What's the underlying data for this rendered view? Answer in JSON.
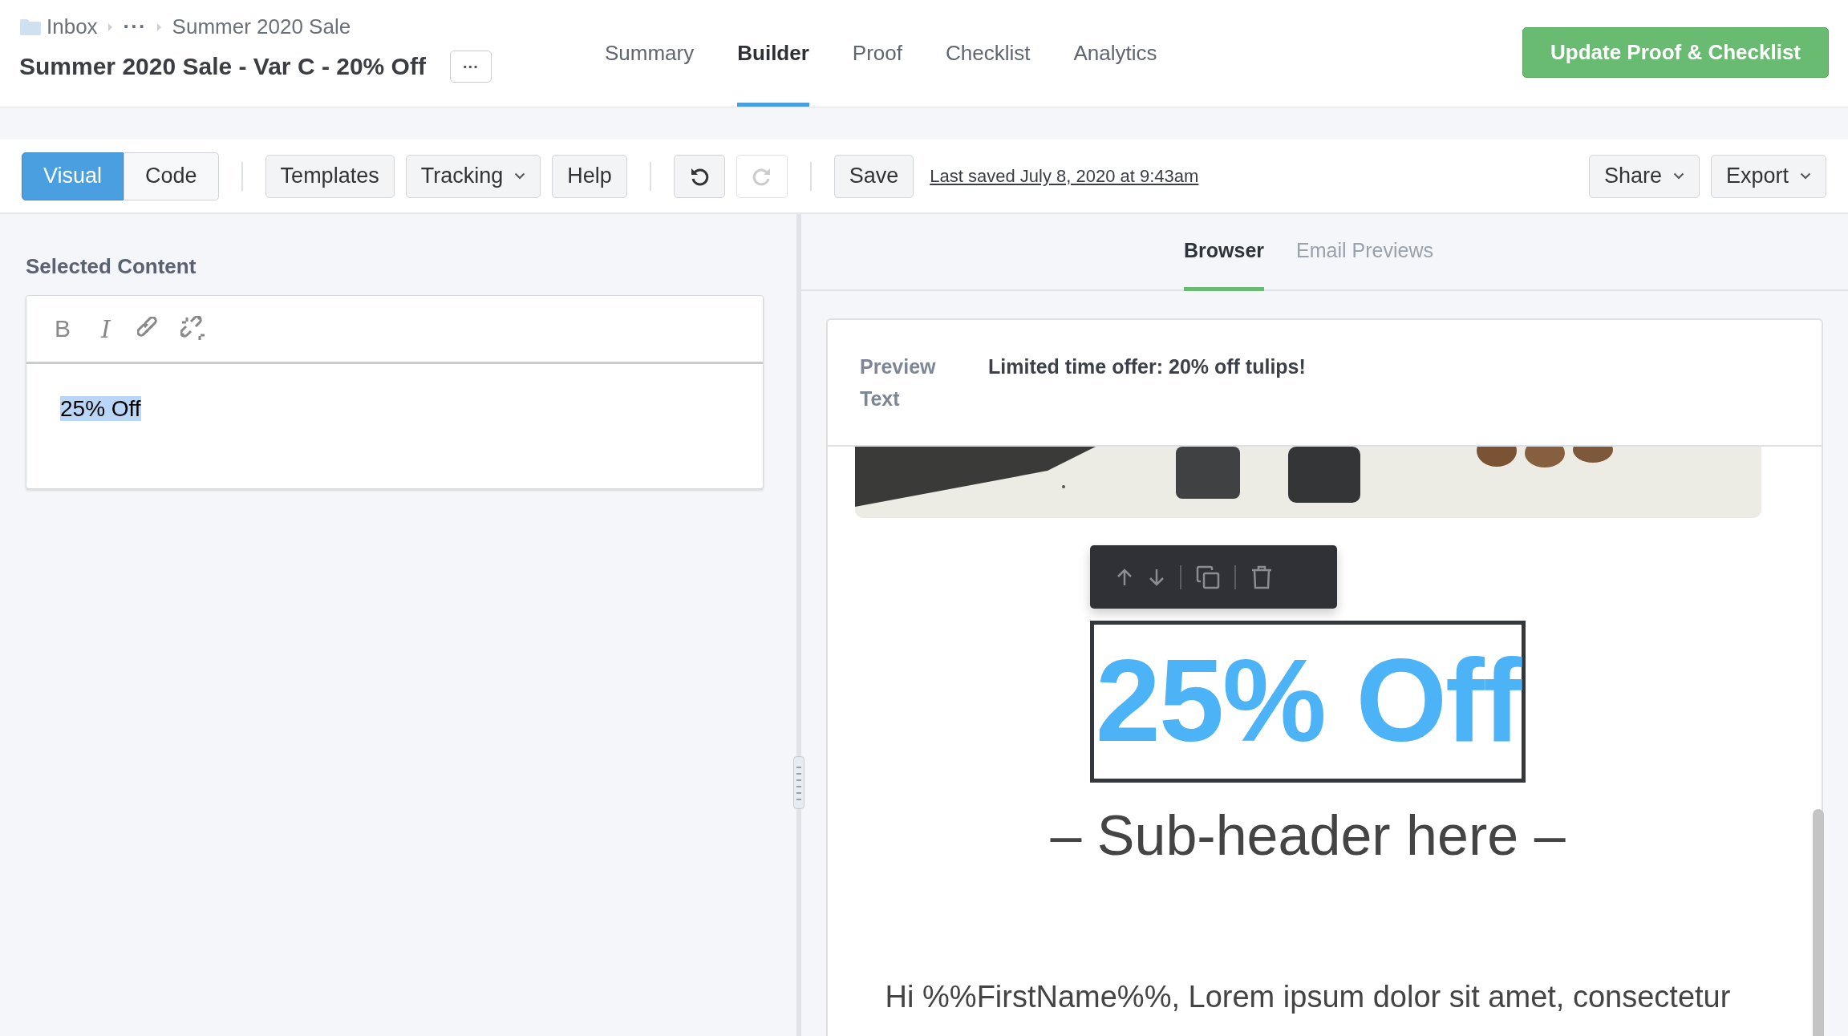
{
  "breadcrumb": [
    {
      "label": "Inbox",
      "kind": "folder"
    },
    {
      "label": "···",
      "kind": "more"
    },
    {
      "label": "Summer 2020 Sale",
      "kind": "text"
    }
  ],
  "title": "Summer 2020 Sale - Var C - 20% Off",
  "title_menu": "···",
  "nav_tabs": [
    {
      "label": "Summary",
      "selected": false
    },
    {
      "label": "Builder",
      "selected": true
    },
    {
      "label": "Proof",
      "selected": false
    },
    {
      "label": "Checklist",
      "selected": false
    },
    {
      "label": "Analytics",
      "selected": false
    }
  ],
  "primary_action": "Update Proof & Checklist",
  "toolbar": {
    "modes": [
      {
        "label": "Visual",
        "selected": true
      },
      {
        "label": "Code",
        "selected": false
      }
    ],
    "buttons": [
      {
        "label": "Templates",
        "kind": "plain"
      },
      {
        "label": "Tracking",
        "kind": "dropdown"
      },
      {
        "label": "Help",
        "kind": "plain"
      }
    ],
    "undo": {
      "disabled": false
    },
    "redo": {
      "disabled": true
    },
    "save": "Save",
    "last_saved": "Last saved July 8, 2020 at 9:43am",
    "right_buttons": [
      {
        "label": "Share",
        "kind": "dropdown"
      },
      {
        "label": "Export",
        "kind": "dropdown"
      }
    ]
  },
  "editor": {
    "heading": "Selected Content",
    "format_buttons": [
      {
        "label": "B",
        "kind": "bold"
      },
      {
        "label": "I",
        "kind": "italic"
      }
    ],
    "content": "25% Off"
  },
  "preview": {
    "tabs": [
      {
        "label": "Browser",
        "selected": true
      },
      {
        "label": "Email Previews",
        "selected": false
      }
    ],
    "preview_text_label": "Preview Text",
    "preview_text": "Limited time offer: 20% off tulips!",
    "headline": "25% Off",
    "subheader": "– Sub-header here –",
    "body": "Hi %%FirstName%%, Lorem ipsum dolor sit amet, consectetur"
  }
}
